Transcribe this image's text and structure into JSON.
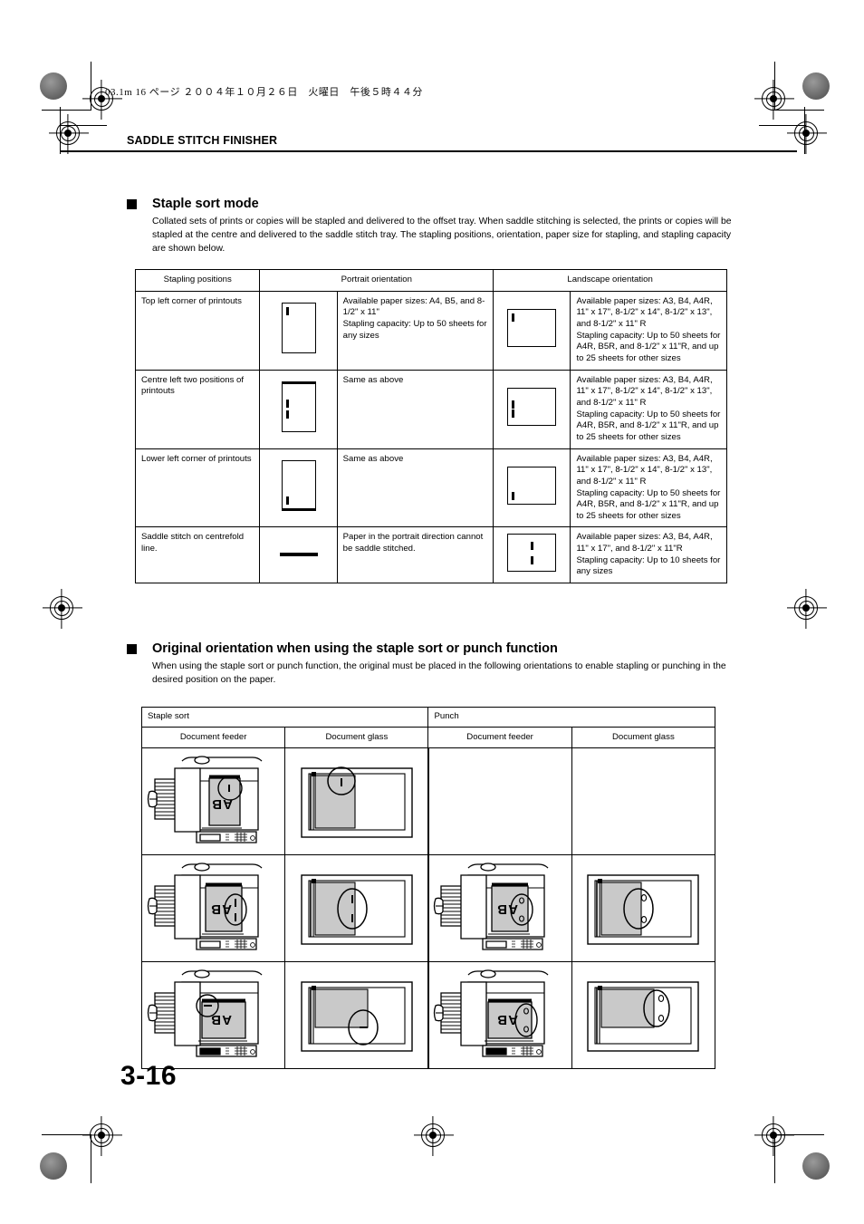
{
  "page": {
    "jp_header": "03.1m  16 ページ  ２００４年１０月２６日　火曜日　午後５時４４分",
    "running_head": "SADDLE STITCH FINISHER",
    "page_number": "3-16"
  },
  "section_staple_sort": {
    "title": "Staple sort mode",
    "paragraph": "Collated sets of prints or copies will be stapled and delivered to the offset tray. When saddle stitching is selected, the prints or copies will be stapled at the centre and delivered to the saddle stitch tray. The stapling positions, orientation, paper size for stapling, and stapling capacity are shown below."
  },
  "table_staple_positions": {
    "headers": {
      "positions": "Stapling positions",
      "portrait": "Portrait orientation",
      "landscape": "Landscape orientation"
    },
    "rows": [
      {
        "position": "Top left corner of printouts",
        "portrait_icon": "paper-portrait-staple-top-left",
        "portrait_text": "Available paper sizes: A4, B5, and 8-1/2\" x 11\"\nStapling capacity: Up to 50 sheets for any sizes",
        "landscape_icon": "paper-landscape-staple-top-left",
        "landscape_text": "Available paper sizes: A3, B4, A4R, 11\" x 17\", 8-1/2\" x 14\", 8-1/2\" x 13\", and 8-1/2\" x 11\" R\nStapling capacity: Up to 50 sheets for A4R, B5R, and 8-1/2\" x 11\"R, and up to 25 sheets for other sizes"
      },
      {
        "position": "Centre left two positions of printouts",
        "portrait_icon": "paper-portrait-staple-centre-left-two",
        "portrait_text": "Same as above",
        "landscape_icon": "paper-landscape-staple-centre-left-two",
        "landscape_text": "Available paper sizes: A3, B4, A4R, 11\" x 17\", 8-1/2\" x 14\", 8-1/2\" x 13\", and 8-1/2\" x 11\" R\nStapling capacity: Up to 50 sheets for A4R, B5R, and 8-1/2\" x 11\"R, and up to 25 sheets for other sizes"
      },
      {
        "position": "Lower left corner of printouts",
        "portrait_icon": "paper-portrait-staple-lower-left",
        "portrait_text": "Same as above",
        "landscape_icon": "paper-landscape-staple-lower-left",
        "landscape_text": "Available paper sizes: A3, B4, A4R, 11\" x 17\", 8-1/2\" x 14\", 8-1/2\" x 13\", and 8-1/2\" x 11\" R\nStapling capacity: Up to 50 sheets for A4R, B5R, and 8-1/2\" x 11\"R, and up to 25 sheets for other sizes"
      },
      {
        "position": "Saddle stitch on centrefold line.",
        "portrait_icon": "dash-not-available",
        "portrait_text": "Paper in the portrait direction cannot be saddle stitched.",
        "landscape_icon": "paper-landscape-saddle-stitch-centre",
        "landscape_text": "Available paper sizes: A3, B4, A4R, 11\" x 17\", and 8-1/2\" x 11\"R\nStapling capacity: Up to 10 sheets for any sizes"
      }
    ]
  },
  "section_original_orientation": {
    "title": "Original orientation when using the staple sort or punch function",
    "paragraph": "When using the staple sort or punch function, the original must be placed in the following orientations to enable stapling or punching in the desired position on the paper."
  },
  "table_orientation": {
    "group_headers": {
      "staple_sort": "Staple sort",
      "punch": "Punch"
    },
    "sub_headers": {
      "feeder": "Document feeder",
      "glass": "Document glass"
    },
    "rows": [
      {
        "staple_feeder": "copier-feeder-portrait-staple-top",
        "staple_glass": "glass-portrait-staple-top",
        "punch_feeder": "",
        "punch_glass": ""
      },
      {
        "staple_feeder": "copier-feeder-portrait-staple-right",
        "staple_glass": "glass-portrait-staple-right",
        "punch_feeder": "copier-feeder-portrait-punch-right",
        "punch_glass": "glass-portrait-punch-right"
      },
      {
        "staple_feeder": "copier-feeder-landscape-staple-left",
        "staple_glass": "glass-landscape-staple-bottom",
        "punch_feeder": "copier-feeder-landscape-punch-right",
        "punch_glass": "glass-landscape-punch-right"
      }
    ],
    "original_label_front": "A",
    "original_label_back": "B"
  },
  "colors": {
    "ink": "#000000",
    "paper_fill": "#c9c9c9",
    "page_bg": "#ffffff"
  }
}
